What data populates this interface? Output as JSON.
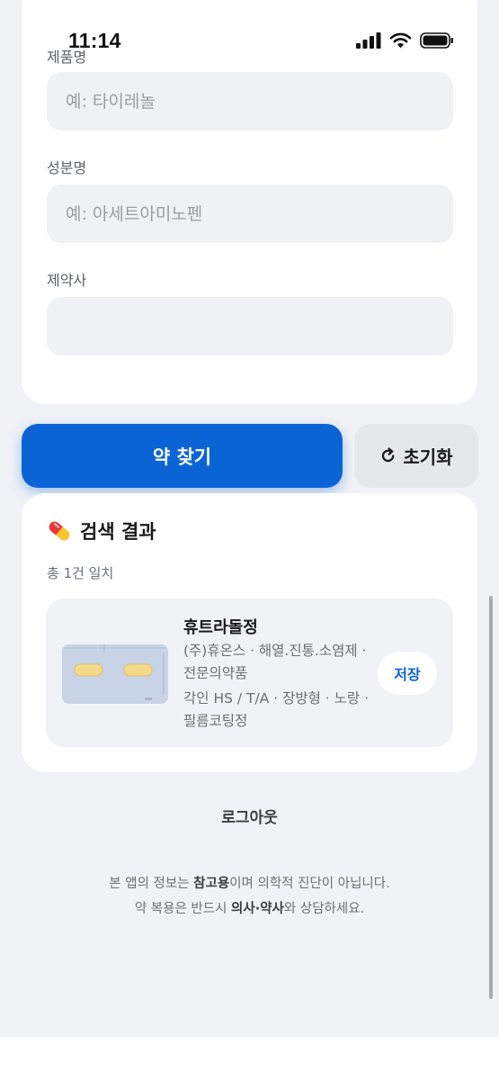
{
  "status_bar": {
    "time": "11:14"
  },
  "form": {
    "product_label": "제품명",
    "product_placeholder": "예: 타이레놀",
    "product_value": "",
    "ingredient_label": "성분명",
    "ingredient_placeholder": "예: 아세트아미노펜",
    "ingredient_value": "",
    "maker_label": "제약사",
    "maker_placeholder": "",
    "maker_value": ""
  },
  "actions": {
    "search_label": "약 찾기",
    "reset_label": "초기화"
  },
  "results": {
    "title": "검색 결과",
    "count_text": "총 1건 일치",
    "items": [
      {
        "name": "휴트라돌정",
        "maker_line": "(주)휴온스 · 해열.진통.소염제 · 전문의약품",
        "shape_line": "각인 HS / T/A · 장방형 · 노랑 · 필름코팅정",
        "save_label": "저장"
      }
    ]
  },
  "logout_label": "로그아웃",
  "disclaimer": {
    "line1_a": "본 앱의 정보는 ",
    "line1_b": "참고용",
    "line1_c": "이며 의학적 진단이 아닙니다.",
    "line2_a": "약 복용은 반드시 ",
    "line2_b": "의사·약사",
    "line2_c": "와 상담하세요."
  },
  "colors": {
    "primary": "#0a64d6",
    "background": "#f1f2f6",
    "card": "#ffffff",
    "input_bg": "#eff1f4"
  },
  "icons": {
    "pill": "pill-icon",
    "reset": "refresh-icon",
    "signal": "signal-icon",
    "wifi": "wifi-icon",
    "battery": "battery-icon"
  }
}
